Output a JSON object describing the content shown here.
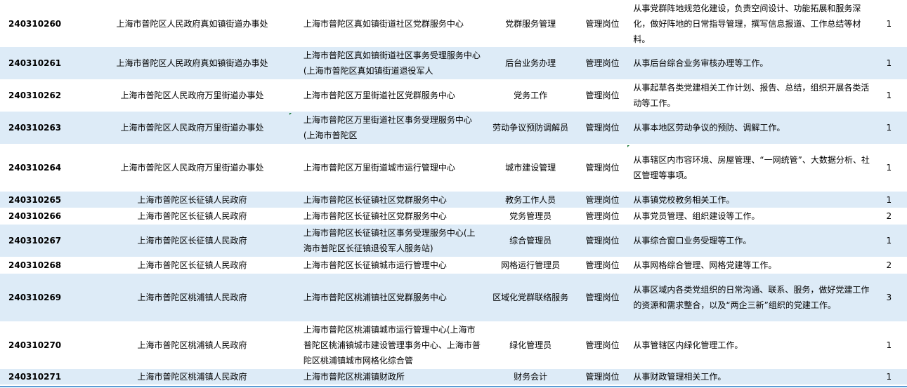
{
  "rows": [
    {
      "id": "240310260",
      "dept": "上海市普陀区人民政府真如镇街道办事处",
      "unit": "上海市普陀区真如镇街道社区党群服务中心",
      "position": "党群服务管理",
      "type": "管理岗位",
      "desc": "从事党群阵地规范化建设，负责空间设计、功能拓展和服务深化，做好阵地的日常指导管理，撰写信息报道、工作总结等材料。",
      "count": "1"
    },
    {
      "id": "240310261",
      "dept": "上海市普陀区人民政府真如镇街道办事处",
      "unit": "上海市普陀区真如镇街道社区事务受理服务中心(上海市普陀区真如镇街道退役军人",
      "position": "后台业务办理",
      "type": "管理岗位",
      "desc": "从事后台综合业务审核办理等工作。",
      "count": "1"
    },
    {
      "id": "240310262",
      "dept": "上海市普陀区人民政府万里街道办事处",
      "unit": "上海市普陀区万里街道社区党群服务中心",
      "position": "党务工作",
      "type": "管理岗位",
      "desc": "从事起草各类党建相关工作计划、报告、总结，组织开展各类活动等工作。",
      "count": "1"
    },
    {
      "id": "240310263",
      "dept": "上海市普陀区人民政府万里街道办事处",
      "unit": "上海市普陀区万里街道社区事务受理服务中心(上海市普陀区",
      "position": "劳动争议预防调解员",
      "type": "管理岗位",
      "desc": "从事本地区劳动争议的预防、调解工作。",
      "count": "1"
    },
    {
      "id": "240310264",
      "dept": "上海市普陀区人民政府万里街道办事处",
      "unit": "上海市普陀区万里街道城市运行管理中心",
      "position": "城市建设管理",
      "type": "管理岗位",
      "desc": "从事辖区内市容环境、房屋管理、“一网统管”、大数据分析、社区管理等事项。",
      "count": "1"
    },
    {
      "id": "240310265",
      "dept": "上海市普陀区长征镇人民政府",
      "unit": "上海市普陀区长征镇社区党群服务中心",
      "position": "教务工作人员",
      "type": "管理岗位",
      "desc": "从事镇党校教务相关工作。",
      "count": "1"
    },
    {
      "id": "240310266",
      "dept": "上海市普陀区长征镇人民政府",
      "unit": "上海市普陀区长征镇社区党群服务中心",
      "position": "党务管理员",
      "type": "管理岗位",
      "desc": "从事党员管理、组织建设等工作。",
      "count": "2"
    },
    {
      "id": "240310267",
      "dept": "上海市普陀区长征镇人民政府",
      "unit": "上海市普陀区长征镇社区事务受理服务中心(上海市普陀区长征镇退役军人服务站)",
      "position": "综合管理员",
      "type": "管理岗位",
      "desc": "从事综合窗口业务受理等工作。",
      "count": "1"
    },
    {
      "id": "240310268",
      "dept": "上海市普陀区长征镇人民政府",
      "unit": "上海市普陀区长征镇城市运行管理中心",
      "position": "网格运行管理员",
      "type": "管理岗位",
      "desc": "从事网格综合管理、网格党建等工作。",
      "count": "2"
    },
    {
      "id": "240310269",
      "dept": "上海市普陀区桃浦镇人民政府",
      "unit": "上海市普陀区桃浦镇社区党群服务中心",
      "position": "区域化党群联络服务",
      "type": "管理岗位",
      "desc": "从事区域内各类党组织的日常沟通、联系、服务，做好党建工作的资源和需求整合，以及“两企三新”组织的党建工作。",
      "count": "3"
    },
    {
      "id": "240310270",
      "dept": "上海市普陀区桃浦镇人民政府",
      "unit": "上海市普陀区桃浦镇城市运行管理中心(上海市普陀区桃浦镇城市建设管理事务中心、上海市普陀区桃浦镇城市网格化综合管",
      "position": "绿化管理员",
      "type": "管理岗位",
      "desc": "从事管辖区内绿化管理工作。",
      "count": "1"
    },
    {
      "id": "240310271",
      "dept": "上海市普陀区桃浦镇人民政府",
      "unit": "上海市普陀区桃浦镇财政所",
      "position": "财务会计",
      "type": "管理岗位",
      "desc": "从事财政管理相关工作。",
      "count": "1"
    }
  ]
}
